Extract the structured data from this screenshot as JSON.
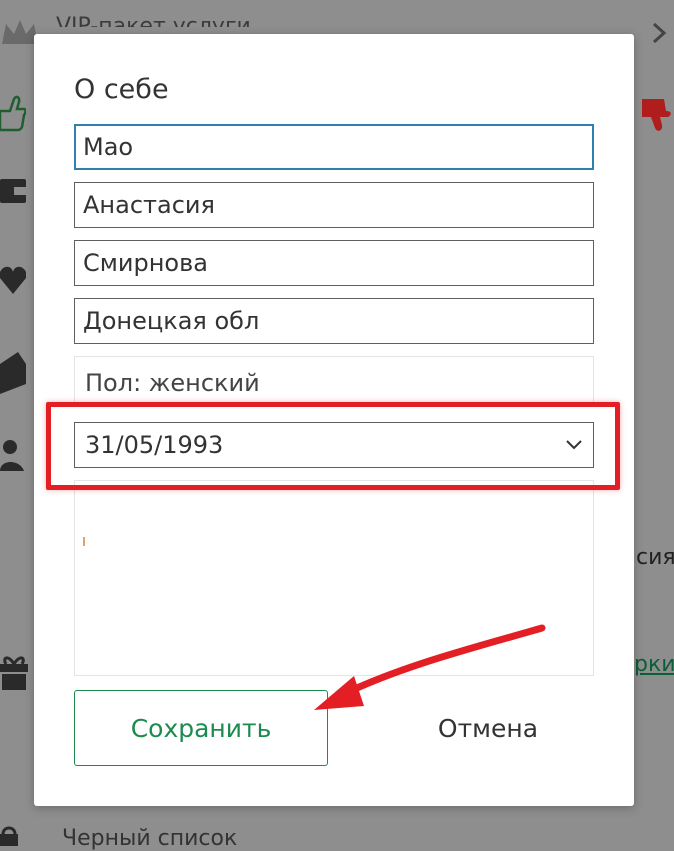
{
  "background": {
    "top_title": "VIP-пакет услуги",
    "right_text_1": "сия",
    "right_text_2": "рки",
    "bottom_text": "Черный список"
  },
  "modal": {
    "title": "О себе",
    "fields": {
      "nickname": "Мао",
      "first_name": "Анастасия",
      "last_name": "Смирнова",
      "region": "Донецкая обл"
    },
    "gender": "Пол: женский",
    "birth_date": "31/05/1993",
    "about": "",
    "save_label": "Сохранить",
    "cancel_label": "Отмена"
  },
  "icons": {
    "date_dropdown": "chevron-down-icon",
    "annotation": "red-arrow-icon"
  },
  "colors": {
    "accent_green": "#1d8a50",
    "focus_blue": "#2f7fb0",
    "highlight_red": "#e31e24",
    "overlay_gray": "#8e8e8e"
  }
}
